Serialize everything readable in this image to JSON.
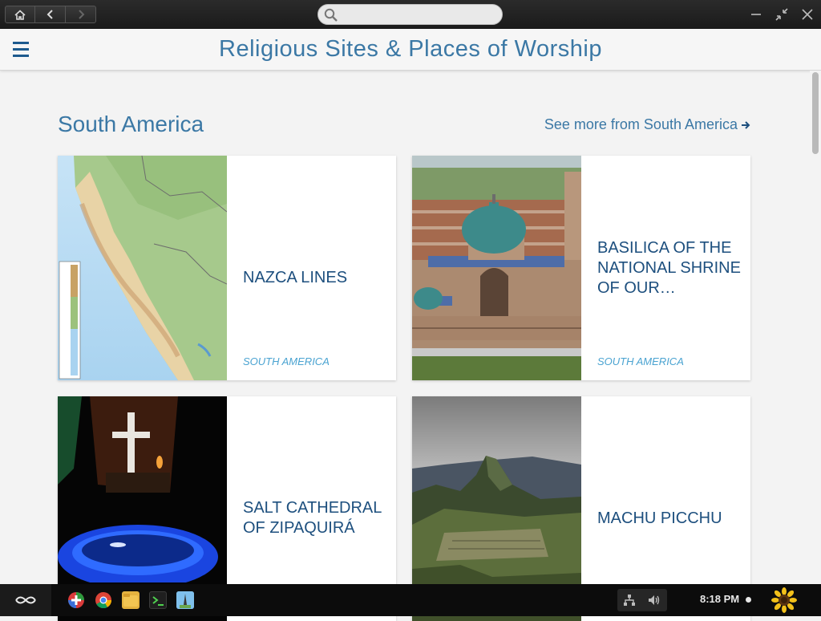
{
  "titlebar": {
    "search_placeholder": "",
    "icons": [
      "home-icon",
      "back-icon",
      "forward-icon",
      "search-icon",
      "minimize-icon",
      "unmaximize-icon",
      "close-icon"
    ]
  },
  "header": {
    "title": "Religious Sites & Places of Worship"
  },
  "section": {
    "title": "South America",
    "see_more": "See more from South America"
  },
  "cards": [
    {
      "title": "NAZCA LINES",
      "region": "SOUTH AMERICA"
    },
    {
      "title": "BASILICA OF THE NATIONAL SHRINE OF OUR…",
      "region": "SOUTH AMERICA"
    },
    {
      "title": "SALT CATHEDRAL OF ZIPAQUIRÁ",
      "region": ""
    },
    {
      "title": "MACHU PICCHU",
      "region": ""
    }
  ],
  "taskbar": {
    "apps": [
      "app-store-icon",
      "chrome-icon",
      "files-icon",
      "terminal-icon",
      "travel-app-icon"
    ],
    "clock": "8:18 PM"
  },
  "colors": {
    "accent": "#3b78a5",
    "card_title": "#1d4f7e",
    "region": "#4aa3d1"
  }
}
